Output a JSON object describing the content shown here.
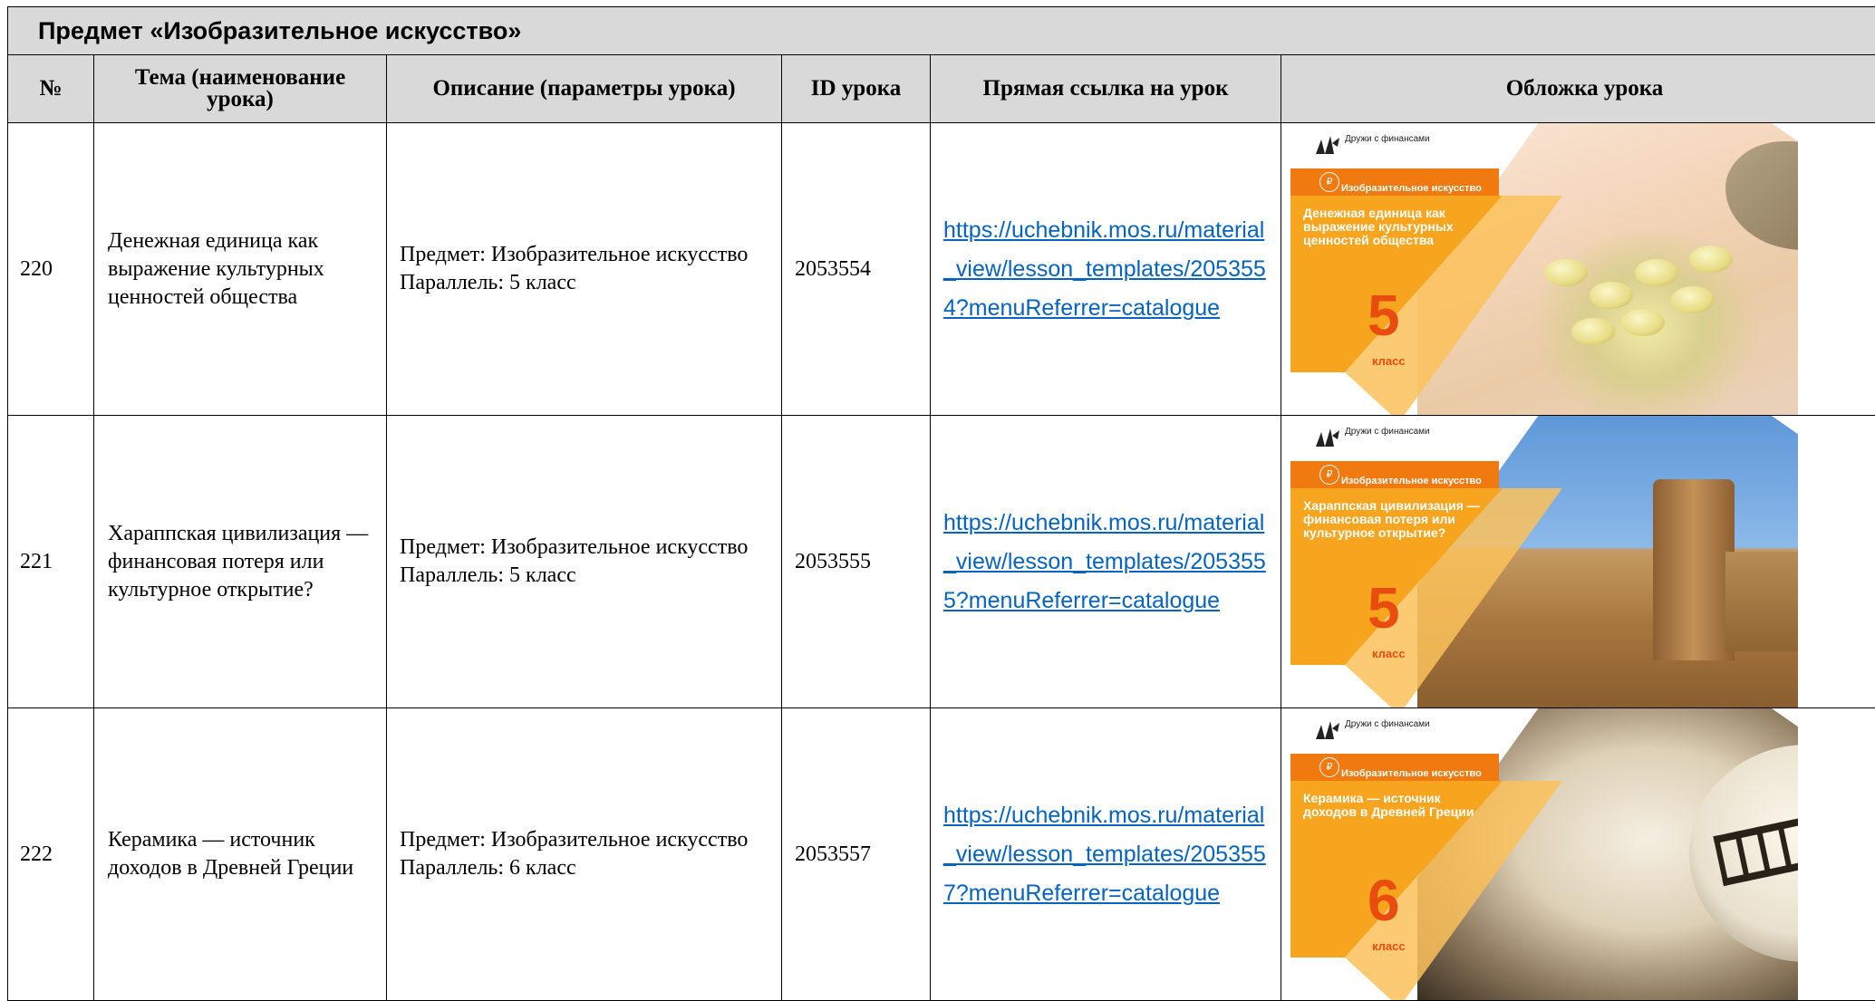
{
  "subject": {
    "title": "Предмет «Изобразительное искусство»"
  },
  "columns": [
    {
      "line1": "№",
      "line2": ""
    },
    {
      "line1": "Тема (наименование",
      "line2": "урока)"
    },
    {
      "line1": "Описание (параметры урока)",
      "line2": ""
    },
    {
      "line1": "ID урока",
      "line2": ""
    },
    {
      "line1": "Прямая ссылка на урок",
      "line2": ""
    },
    {
      "line1": "Обложка урока",
      "line2": ""
    }
  ],
  "lessons": [
    {
      "number": "220",
      "topic": "Денежная единица как выражение культурных ценностей общества",
      "desc_subject": "Предмет: Изобразительное искусство",
      "desc_grade": "Параллель: 5 класс",
      "id": "2053554",
      "link": "https://uchebnik.mos.ru/material_view/lesson_templates/2053554?menuReferrer=catalogue",
      "cover": {
        "logo": "Дружи с финансами",
        "band": "Изобразительное искусство",
        "title": "Денежная единица как выражение культурных ценностей общества",
        "grade": "5",
        "grade_label": "класс",
        "icon": "coin-icon"
      }
    },
    {
      "number": "221",
      "topic": "Хараппская цивилизация — финансовая потеря или культурное открытие?",
      "desc_subject": "Предмет: Изобразительное искусство",
      "desc_grade": "Параллель: 5 класс",
      "id": "2053555",
      "link": "https://uchebnik.mos.ru/material_view/lesson_templates/2053555?menuReferrer=catalogue",
      "cover": {
        "logo": "Дружи с финансами",
        "band": "Изобразительное искусство",
        "title": "Хараппская цивилизация — финансовая потеря или культурное открытие?",
        "grade": "5",
        "grade_label": "класс",
        "icon": "coin-icon"
      }
    },
    {
      "number": "222",
      "topic": "Керамика — источник доходов в Древней Греции",
      "desc_subject": "Предмет: Изобразительное искусство",
      "desc_grade": "Параллель: 6 класс",
      "id": "2053557",
      "link": "https://uchebnik.mos.ru/material_view/lesson_templates/2053557?menuReferrer=catalogue",
      "cover": {
        "logo": "Дружи с финансами",
        "band": "Изобразительное искусство",
        "title": "Керамика — источник доходов в Древней Греции",
        "grade": "6",
        "grade_label": "класс",
        "icon": "coin-icon"
      }
    }
  ]
}
